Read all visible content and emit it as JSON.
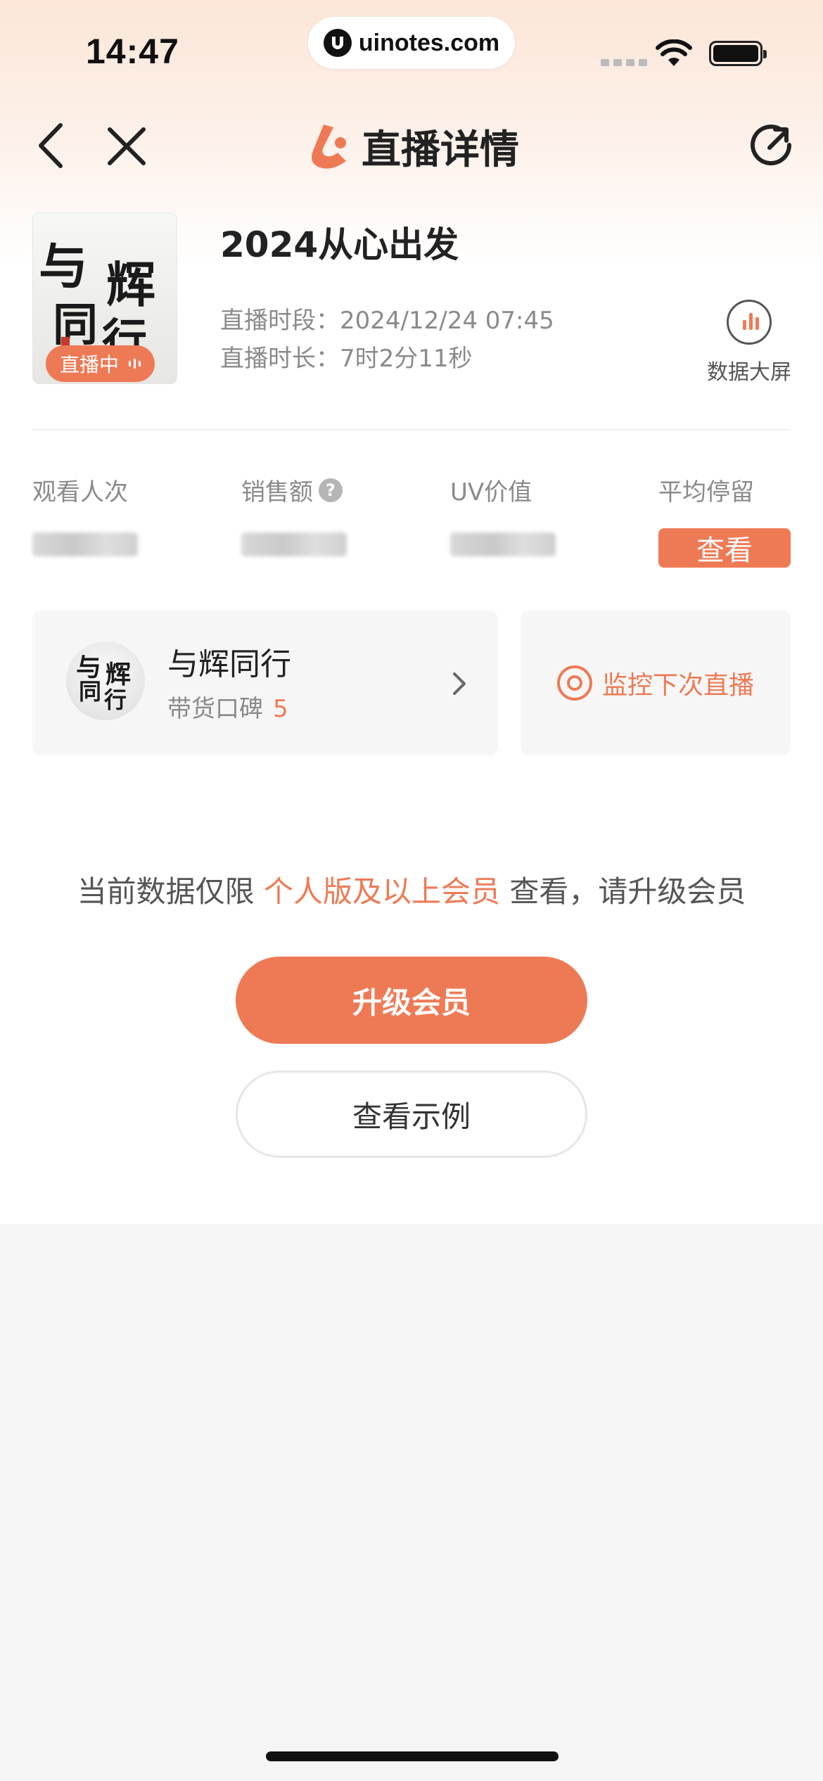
{
  "status_bar": {
    "time": "14:47",
    "url": "uinotes.com"
  },
  "nav": {
    "title": "直播详情",
    "icons": [
      "back-icon",
      "close-icon",
      "app-logo-icon",
      "refresh-icon"
    ]
  },
  "live": {
    "cover_text": "与辉同行",
    "badge": "直播中",
    "title": "2024从心出发",
    "period_label": "直播时段：",
    "period_value": "2024/12/24 07:45",
    "duration_label": "直播时长：",
    "duration_value": "7时2分11秒",
    "bigscreen_label": "数据大屏"
  },
  "metrics": [
    {
      "label": "观看人次",
      "value_hidden": true
    },
    {
      "label": "销售额",
      "help": "?",
      "value_hidden": true
    },
    {
      "label": "UV价值",
      "value_hidden": true
    },
    {
      "label": "平均停留",
      "button": "查看"
    }
  ],
  "anchor": {
    "name": "与辉同行",
    "avatar_text": "与辉同行",
    "reputation_label": "带货口碑",
    "reputation_score": "5"
  },
  "monitor": {
    "label": "监控下次直播"
  },
  "notice": {
    "prefix": "当前数据仅限 ",
    "highlight": "个人版及以上会员",
    "suffix": " 查看，请升级会员"
  },
  "buttons": {
    "upgrade": "升级会员",
    "example": "查看示例"
  },
  "colors": {
    "accent": "#ee7a55",
    "text_primary": "#222222",
    "text_secondary": "#8a8a8a",
    "card_bg": "#f6f6f6"
  }
}
